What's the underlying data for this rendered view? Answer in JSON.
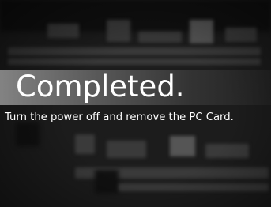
{
  "dialog": {
    "title": "Completed.",
    "message": "Turn the power off and remove the PC Card."
  }
}
